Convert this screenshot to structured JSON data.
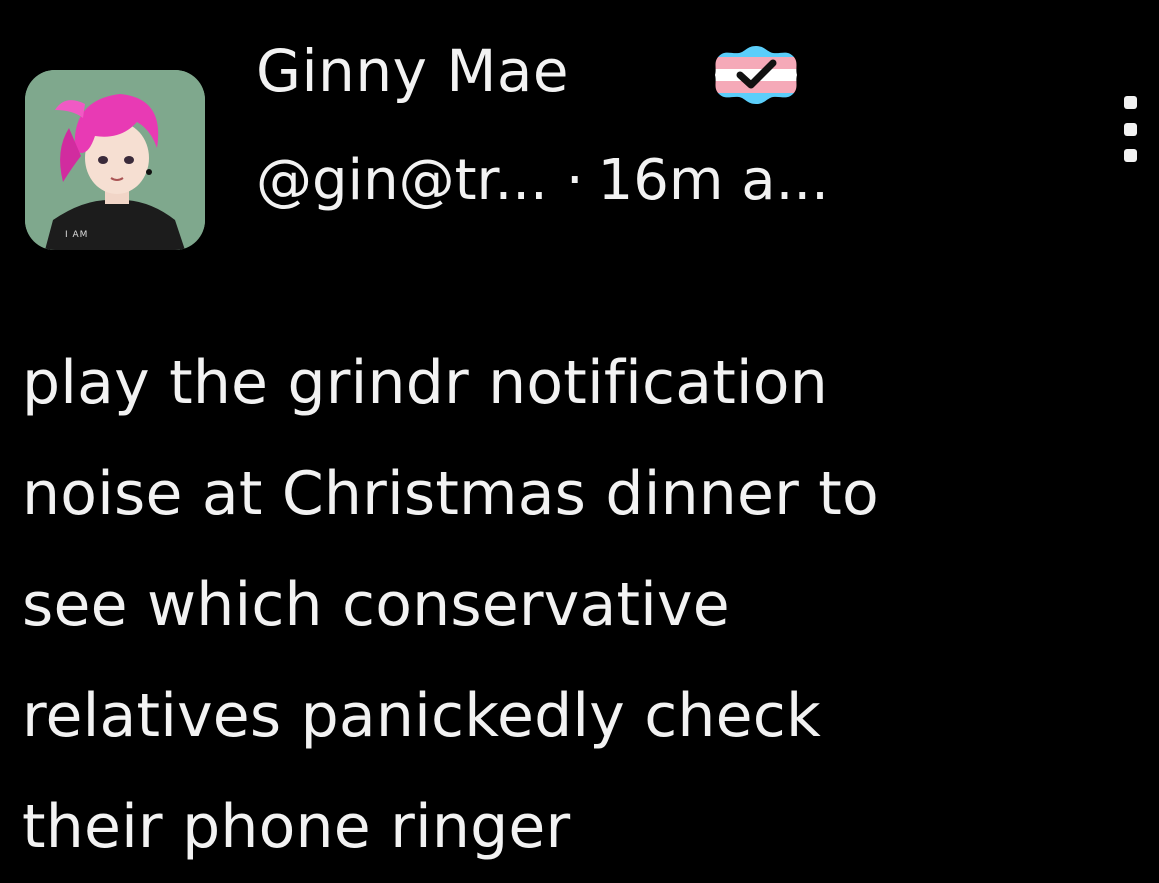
{
  "author": {
    "display_name": "Ginny Mae",
    "handle": "@gin@tr...",
    "separator": "·",
    "timestamp": "16m a...",
    "badge_icon": "verified-check-icon",
    "badge_colors": [
      "#5bcefa",
      "#f5a9b8",
      "#ffffff"
    ],
    "avatar_shirt_text": "I AM"
  },
  "actions": {
    "more_icon": "more-vertical-icon"
  },
  "post": {
    "lines": [
      "play the grindr notification",
      "noise at Christmas dinner to",
      "see which conservative",
      "relatives panickedly check",
      "their phone ringer"
    ]
  },
  "colors": {
    "background": "#000000",
    "text": "#f2f2f2",
    "avatar_bg": "#7fa88d",
    "avatar_hair": "#e83ab4"
  }
}
